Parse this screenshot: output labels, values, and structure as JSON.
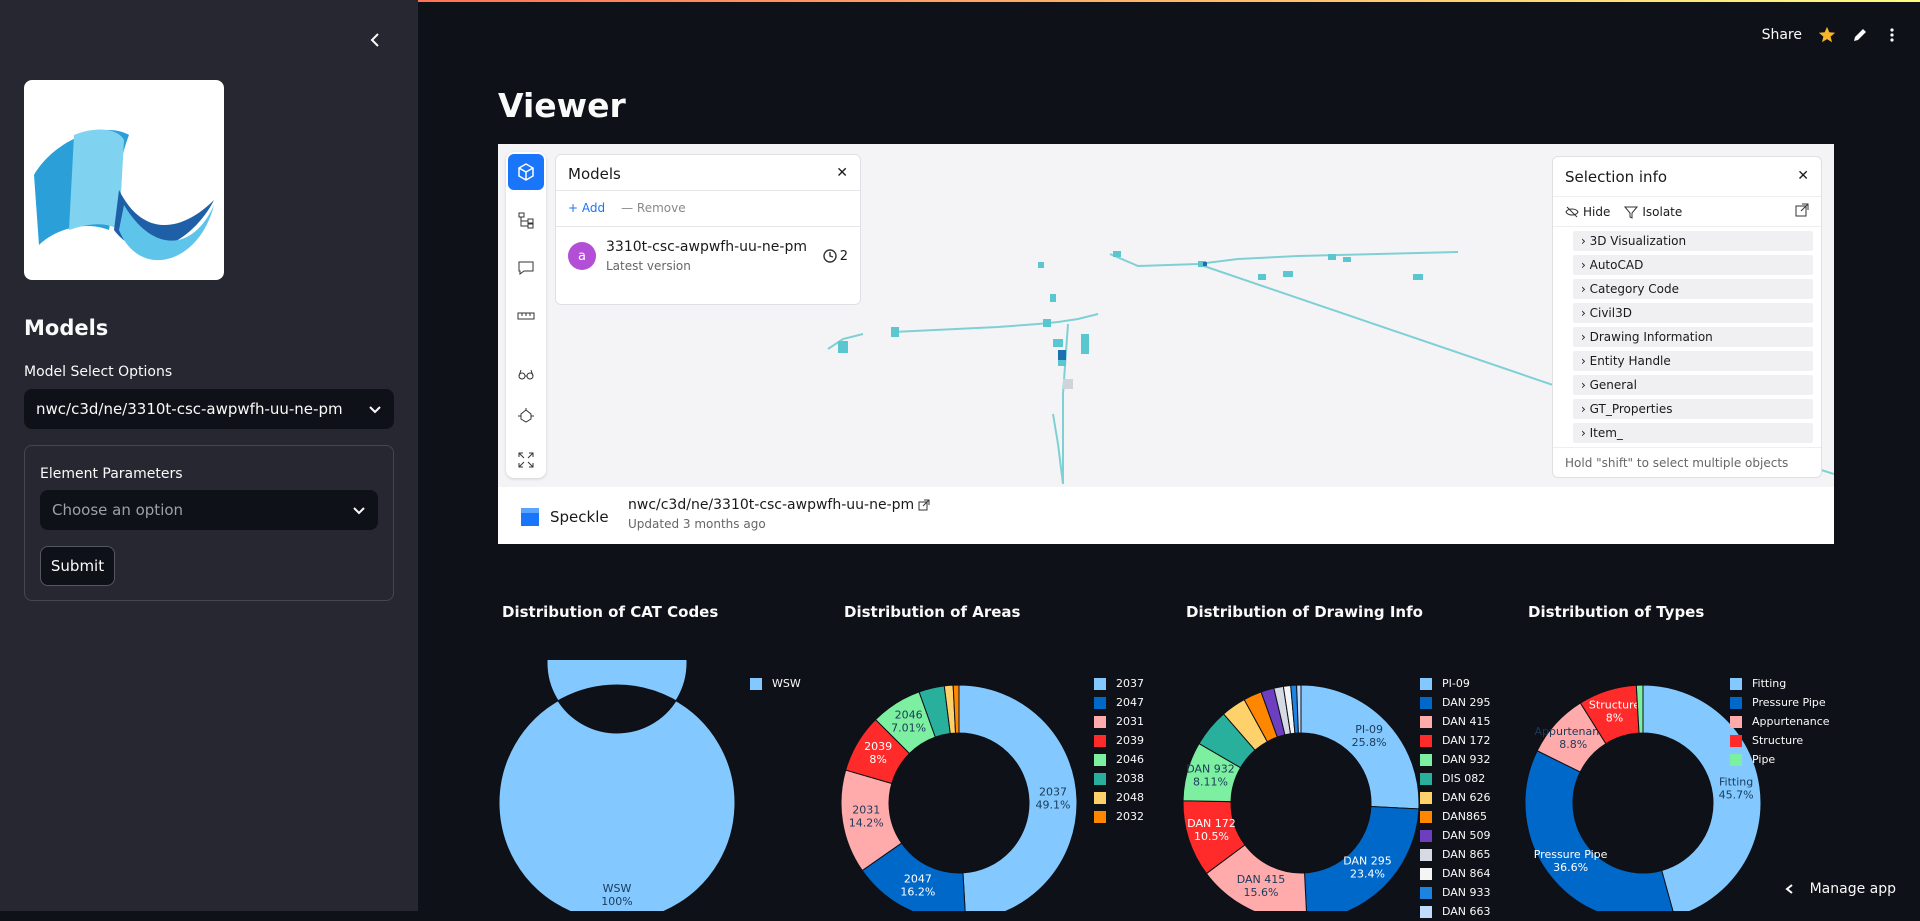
{
  "sidebar": {
    "title": "Models",
    "model_select_label": "Model Select Options",
    "model_select_value": "nwc/c3d/ne/3310t-csc-awpwfh-uu-ne-pm",
    "form_label": "Element Parameters",
    "form_placeholder": "Choose an option",
    "submit_label": "Submit"
  },
  "header": {
    "share_label": "Share",
    "manage_app_label": "Manage app"
  },
  "page_title": "Viewer",
  "viewer": {
    "models_panel": {
      "title": "Models",
      "add_label": "+ Add",
      "remove_label": "— Remove",
      "model_avatar": "a",
      "model_name": "3310t-csc-awpwfh-uu-ne-pm",
      "model_version": "Latest version",
      "history_count": "2"
    },
    "selection_panel": {
      "title": "Selection info",
      "hide_label": "Hide",
      "isolate_label": "Isolate",
      "items": [
        "3D Visualization",
        "AutoCAD",
        "Category Code",
        "Civil3D",
        "Drawing Information",
        "Entity Handle",
        "General",
        "GT_Properties",
        "Item_"
      ],
      "footer": "Hold \"shift\" to select multiple objects"
    },
    "footer": {
      "brand": "Speckle",
      "model_path": "nwc/c3d/ne/3310t-csc-awpwfh-uu-ne-pm",
      "updated": "Updated 3 months ago"
    }
  },
  "chart_data": [
    {
      "type": "pie",
      "title": "Distribution of CAT Codes",
      "categories": [
        "WSW"
      ],
      "values": [
        100
      ],
      "labels": [
        "WSW\n100%"
      ],
      "colors": [
        "#83c9ff"
      ],
      "legend": "top-right"
    },
    {
      "type": "pie",
      "title": "Distribution of Areas",
      "categories": [
        "2037",
        "2047",
        "2031",
        "2039",
        "2046",
        "2038",
        "2048",
        "2032"
      ],
      "values": [
        49.1,
        16.2,
        14.2,
        8,
        7.01,
        3.5,
        1.2,
        0.79
      ],
      "labels": [
        "2037\n49.1%",
        "2047\n16.2%",
        "2031\n14.2%",
        "2039\n8%",
        "2046\n7.01%",
        "",
        "",
        ""
      ],
      "colors": [
        "#83c9ff",
        "#0068c9",
        "#ffabab",
        "#ff2b2b",
        "#7defa1",
        "#29b09d",
        "#ffd16a",
        "#ff8700"
      ],
      "legend": "top-right"
    },
    {
      "type": "pie",
      "title": "Distribution of Drawing Info",
      "categories": [
        "PI-09",
        "DAN 295",
        "DAN 415",
        "DAN 172",
        "DAN 932",
        "DIS 082",
        "DAN 626",
        "DAN865",
        "DAN 509",
        "DAN 865",
        "DAN 864",
        "DAN 933",
        "DAN 663"
      ],
      "values": [
        25.8,
        23.4,
        15.6,
        10.5,
        8.11,
        5.2,
        3.4,
        2.5,
        1.8,
        1.3,
        1.0,
        0.8,
        0.59
      ],
      "labels": [
        "PI-09\n25.8%",
        "DAN 295\n23.4%",
        "DAN 415\n15.6%",
        "DAN 172\n10.5%",
        "DAN 932\n8.11%",
        "",
        "",
        "",
        "",
        "",
        "",
        "",
        ""
      ],
      "colors": [
        "#83c9ff",
        "#0068c9",
        "#ffabab",
        "#ff2b2b",
        "#7defa1",
        "#29b09d",
        "#ffd16a",
        "#ff8700",
        "#6d3fc0",
        "#d5dae5",
        "#f5f5f5",
        "#1c83e1",
        "#bfdbfe"
      ],
      "legend": "top-right"
    },
    {
      "type": "pie",
      "title": "Distribution of Types",
      "categories": [
        "Fitting",
        "Pressure Pipe",
        "Appurtenance",
        "Structure",
        "Pipe"
      ],
      "values": [
        45.7,
        36.6,
        8.8,
        8,
        0.9
      ],
      "labels": [
        "Fitting\n45.7%",
        "Pressure Pipe\n36.6%",
        "Appurtenance\n8.8%",
        "Structure\n8%",
        ""
      ],
      "colors": [
        "#83c9ff",
        "#0068c9",
        "#ffabab",
        "#ff2b2b",
        "#7defa1"
      ],
      "legend": "top-right"
    }
  ]
}
